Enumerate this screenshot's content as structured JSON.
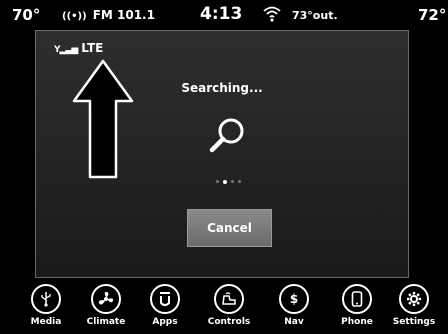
{
  "status_bar": {
    "temp_left": "70°",
    "radio": "FM 101.1",
    "time": "4:13",
    "outside_temp": "73°out.",
    "temp_right": "72°"
  },
  "dialog": {
    "network_label": "LTE",
    "status_text": "Searching...",
    "cancel_label": "Cancel",
    "dots_total": 4,
    "dots_active_index": 1
  },
  "dock": {
    "items": [
      {
        "label": "Media",
        "icon": "usb-icon"
      },
      {
        "label": "Climate",
        "icon": "fan-icon"
      },
      {
        "label": "Apps",
        "icon": "apps-icon"
      },
      {
        "label": "Controls",
        "icon": "controls-icon"
      },
      {
        "label": "Nav",
        "icon": "nav-icon"
      },
      {
        "label": "Phone",
        "icon": "phone-icon"
      },
      {
        "label": "Settings",
        "icon": "gear-icon"
      }
    ]
  },
  "colors": {
    "panel_bg": "#262626",
    "button_bg": "#7b7b7b",
    "text": "#ffffff"
  }
}
